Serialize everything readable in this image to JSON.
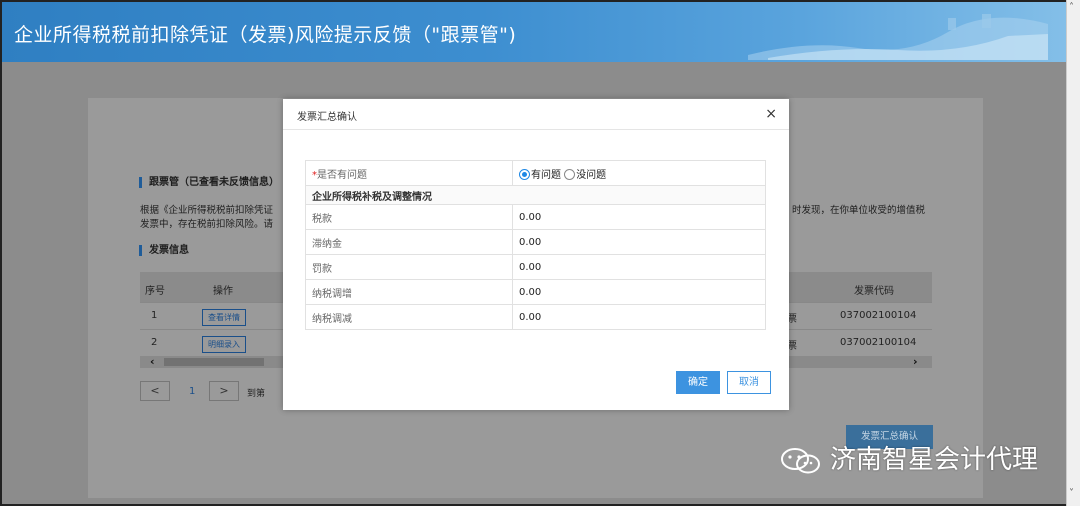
{
  "header": {
    "title": "企业所得税税前扣除凭证（发票)风险提示反馈（\"跟票管\")"
  },
  "background": {
    "section1_title": "跟票管（已查看未反馈信息）",
    "para_line1_left": "根据《企业所得税税前扣除凭证",
    "para_line1_right": "时发现，在你单位收受的增值税",
    "para_line2_left": "发票中，存在税前扣除风险。请",
    "section2_title": "发票信息",
    "columns": {
      "seq": "序号",
      "action": "操作",
      "code": "发票代码"
    },
    "rows": [
      {
        "seq": "1",
        "action": "查看详情",
        "type_tail": "票",
        "code": "037002100104"
      },
      {
        "seq": "2",
        "action": "明细录入",
        "type_tail": "票",
        "code": "037002100104"
      }
    ],
    "pager": {
      "prev": "<",
      "page": "1",
      "next": ">",
      "goto": "到第"
    },
    "summary_button": "发票汇总确认"
  },
  "modal": {
    "title": "发票汇总确认",
    "close": "×",
    "question_required": "*",
    "question_label": "是否有问题",
    "option_yes": "有问题",
    "option_no": "没问题",
    "section_label": "企业所得税补税及调整情况",
    "fields": [
      {
        "label": "税款",
        "value": "0.00"
      },
      {
        "label": "滞纳金",
        "value": "0.00"
      },
      {
        "label": "罚款",
        "value": "0.00"
      },
      {
        "label": "纳税调增",
        "value": "0.00"
      },
      {
        "label": "纳税调减",
        "value": "0.00"
      }
    ],
    "ok": "确定",
    "cancel": "取消"
  },
  "watermark": {
    "text": "济南智星会计代理"
  },
  "colors": {
    "banner": "#3d8ed0",
    "primary": "#3d93e0",
    "required": "#e02020"
  }
}
